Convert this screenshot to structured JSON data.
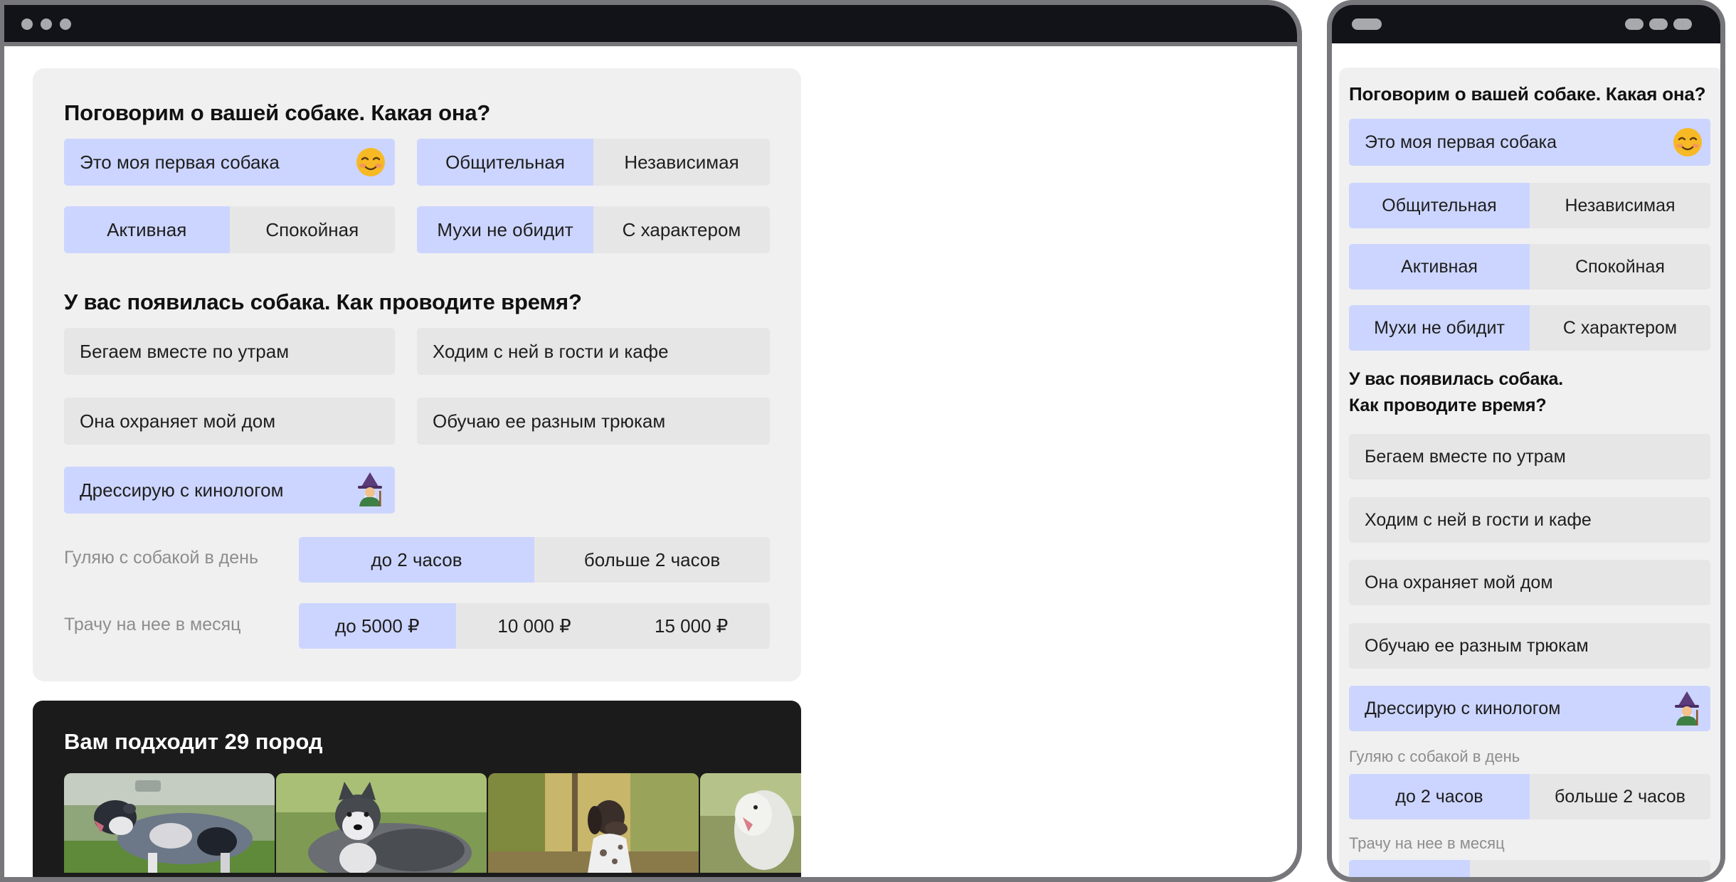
{
  "colors": {
    "selected": "#ccd5ff",
    "chip": "#e6e6e6",
    "panel": "#f0f0f0",
    "frame": "#77777b",
    "topbar": "#111318",
    "result_bg": "#1b1b1b"
  },
  "quiz": {
    "q1_title": "Поговорим о вашей собаке. Какая она?",
    "first_dog": {
      "label": "Это моя первая собака",
      "icon": "smiling-face-icon",
      "selected": true
    },
    "pairs": [
      {
        "a": "Общительная",
        "b": "Независимая",
        "selected": "a"
      },
      {
        "a": "Активная",
        "b": "Спокойная",
        "selected": "a"
      },
      {
        "a": "Мухи не обидит",
        "b": "С характером",
        "selected": "a"
      }
    ],
    "q2_title": "У вас появилась собака. Как проводите время?",
    "q2_title_line1": "У вас появилась собака.",
    "q2_title_line2": "Как проводите время?",
    "activities": [
      {
        "label": "Бегаем вместе по утрам",
        "selected": false
      },
      {
        "label": "Ходим с ней в гости и кафе",
        "selected": false
      },
      {
        "label": "Она охраняет мой дом",
        "selected": false
      },
      {
        "label": "Обучаю ее разным трюкам",
        "selected": false
      },
      {
        "label": "Дрессирую с кинологом",
        "selected": true,
        "icon": "wizard-icon"
      }
    ],
    "walk": {
      "label": "Гуляю с собакой в день",
      "options": [
        "до 2 часов",
        "больше 2 часов"
      ],
      "selected": 0
    },
    "spend": {
      "label": "Трачу на нее в месяц",
      "options": [
        "до 5000 ₽",
        "10 000 ₽",
        "15 000 ₽"
      ],
      "selected": 0
    }
  },
  "result": {
    "title": "Вам подходит 29 пород",
    "photos": [
      "australian-shepherd-photo",
      "malamute-photo",
      "pointer-photo",
      "bedlington-terrier-photo"
    ]
  }
}
